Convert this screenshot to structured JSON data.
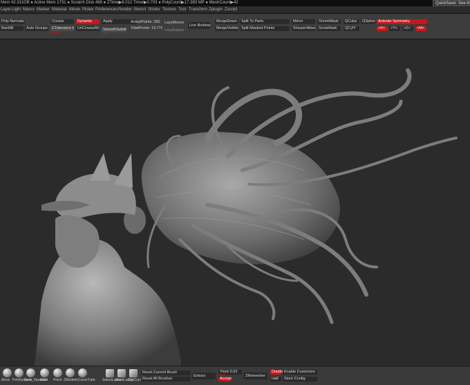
{
  "status_bar": {
    "text": "Mem 42.311GB ● Active Mem 1731 ● Scratch Disk 469 ● ZTime▶6.012 Timer▶0.703 ● PolyCount▶17.383 MP ● MeshCount▶42",
    "quicksave": "QuickSave",
    "see_through": "See-th"
  },
  "menus": [
    "Layer",
    "Light",
    "Macro",
    "Marker",
    "Material",
    "Movie",
    "Picker",
    "Preferences",
    "Render",
    "Stencil",
    "Stroke",
    "Texture",
    "Tool",
    "Transform",
    "Zplugin",
    "Zscript"
  ],
  "toolbar": {
    "row1": {
      "poly_normals": "Poly Normals",
      "crease": "Crease",
      "dynamic": "Dynamic",
      "apply": "Apply",
      "active_points": "ActivePoints: 260",
      "lazymouse": "LazyMouse",
      "live_boolean": "Live Boolean",
      "mergedown": "MergeDown",
      "split_to_parts": "Split To Parts",
      "mirror": "Mirror",
      "shrinkmask": "ShrinkMask",
      "qcube": "QCube",
      "qsphere": "QSphere",
      "activate_symmetry": "Activate Symmetry"
    },
    "row2": {
      "backfacemask": "Backfill",
      "auto_groups": "Auto Groups",
      "ctolerance": "CTolerance 84",
      "uncreaseall": "UnCreaseAll",
      "smoothsubdiv": "SmoothSubdiv",
      "total_points": "TotalPoints: 19.775 Mil",
      "lazyradius": "LazyRadius",
      "mergevisible": "MergeVisible",
      "split_masked_points": "Split Masked Points",
      "sharpenmask": "SharpenMask",
      "growmask": "GrowMask",
      "qcyly": "QCylY",
      "sym_x": ">X<",
      "sym_y": ">Y<",
      "sym_z": ">Z<",
      "sym_m": ">M<"
    }
  },
  "bottom_bar": {
    "brushes": [
      "Move",
      "TrimDynamic",
      "Dam_Standard",
      "Inflat",
      "Pinch",
      "ZModeler",
      "CurveTube"
    ],
    "extra_tools": [
      "SelectLasso",
      "MaskLasso",
      "ClipCurve"
    ],
    "reset_current_brush": "Reset Current Brush",
    "reset_all_brushes": "Reset All Brushes",
    "extract": "Extract",
    "thick_label": "Thick 0.02",
    "accept": "Accept",
    "zremesher": "ZRemesher",
    "double": "Double",
    "half": "Half",
    "enable_customize": "Enable Customize",
    "store_config": "Store Config"
  },
  "colors": {
    "accent_red": "#c8161a",
    "background": "#2b2b2b",
    "toolbar": "#3d3d3d"
  }
}
